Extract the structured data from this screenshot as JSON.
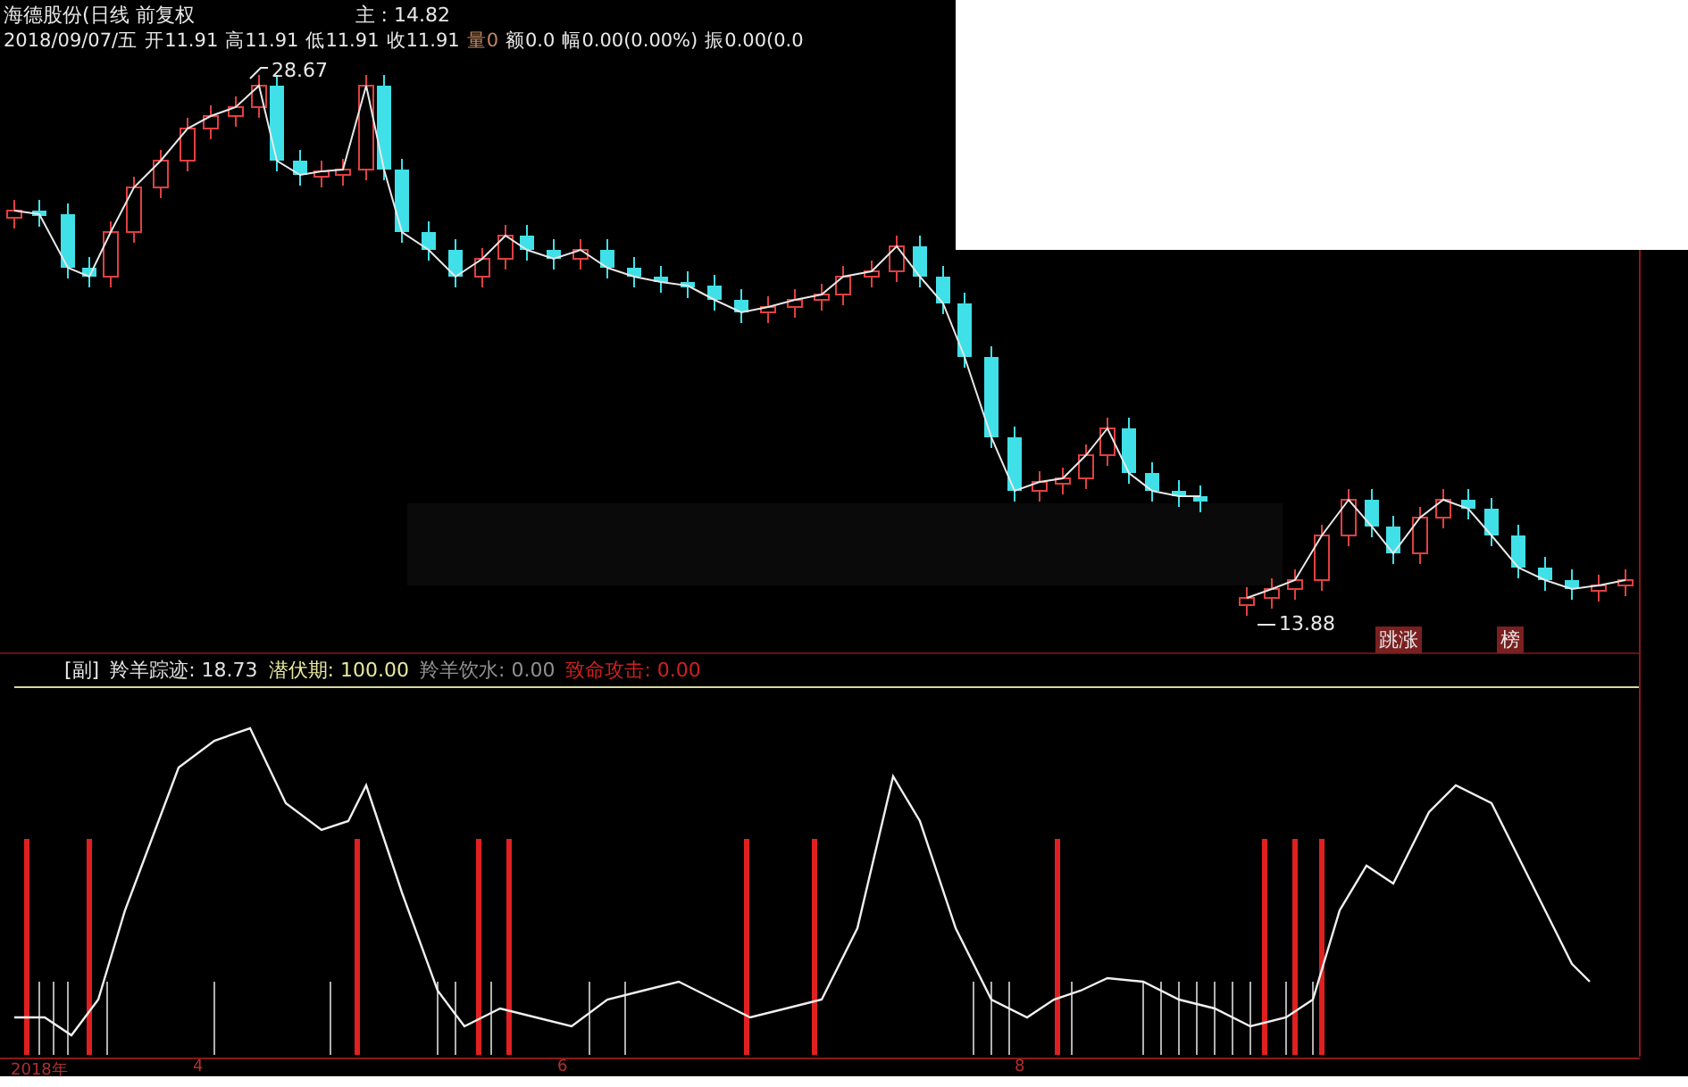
{
  "main_chart": {
    "title": "海德股份(日线 前复权",
    "indicator": "主 : 14.82",
    "quote": [
      {
        "text": "2018/09/07/五",
        "color": "#e8e8e8"
      },
      {
        "text": "开11.91",
        "color": "#e8e8e8"
      },
      {
        "text": "高11.91",
        "color": "#e8e8e8"
      },
      {
        "text": "低11.91",
        "color": "#e8e8e8"
      },
      {
        "text": "收11.91",
        "color": "#e8e8e8"
      },
      {
        "text": "量0",
        "color": "#c08860"
      },
      {
        "text": "额0.0",
        "color": "#e8e8e8"
      },
      {
        "text": "幅0.00(0.00%)",
        "color": "#e8e8e8"
      },
      {
        "text": "振0.00(0.0",
        "color": "#e8e8e8"
      }
    ],
    "high_marker": "28.67",
    "low_marker": "13.88",
    "tags": [
      "跳涨",
      "榜"
    ]
  },
  "sub_chart": {
    "label": "[副]",
    "values": [
      {
        "text": "羚羊踪迹: 18.73",
        "color": "#e0e0e0"
      },
      {
        "text": "潜伏期: 100.00",
        "color": "#e8e8a0"
      },
      {
        "text": "羚羊饮水: 0.00",
        "color": "#909090"
      },
      {
        "text": "致命攻击: 0.00",
        "color": "#d02020"
      }
    ]
  },
  "time_axis": [
    "2018年",
    "4",
    "6",
    "8"
  ]
}
